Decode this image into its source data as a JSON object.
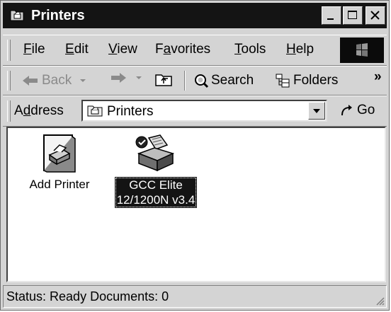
{
  "window": {
    "title": "Printers"
  },
  "caption_buttons": [
    "minimize",
    "maximize",
    "close"
  ],
  "menu": [
    {
      "label": "File",
      "key": "F",
      "rest": "ile"
    },
    {
      "label": "Edit",
      "key": "E",
      "rest": "dit"
    },
    {
      "label": "View",
      "key": "V",
      "rest": "iew"
    },
    {
      "label": "Favorites",
      "key": "a",
      "pre": "F",
      "rest": "vorites"
    },
    {
      "label": "Tools",
      "key": "T",
      "rest": "ools"
    },
    {
      "label": "Help",
      "key": "H",
      "rest": "elp"
    }
  ],
  "toolbar": {
    "back_label": "Back",
    "search_label": "Search",
    "folders_label": "Folders",
    "more": "»"
  },
  "address": {
    "label_pre": "A",
    "label_key": "d",
    "label_rest": "dress",
    "value": "Printers",
    "go_label": "Go"
  },
  "items": [
    {
      "label": "Add Printer",
      "selected": false
    },
    {
      "label": "GCC Elite\n12/1200N v3.4",
      "selected": true
    }
  ],
  "status": {
    "text": "Status: Ready Documents: 0"
  },
  "colors": {
    "title_bar": "#141414",
    "face": "#d4d4d4",
    "selection": "#141414"
  }
}
